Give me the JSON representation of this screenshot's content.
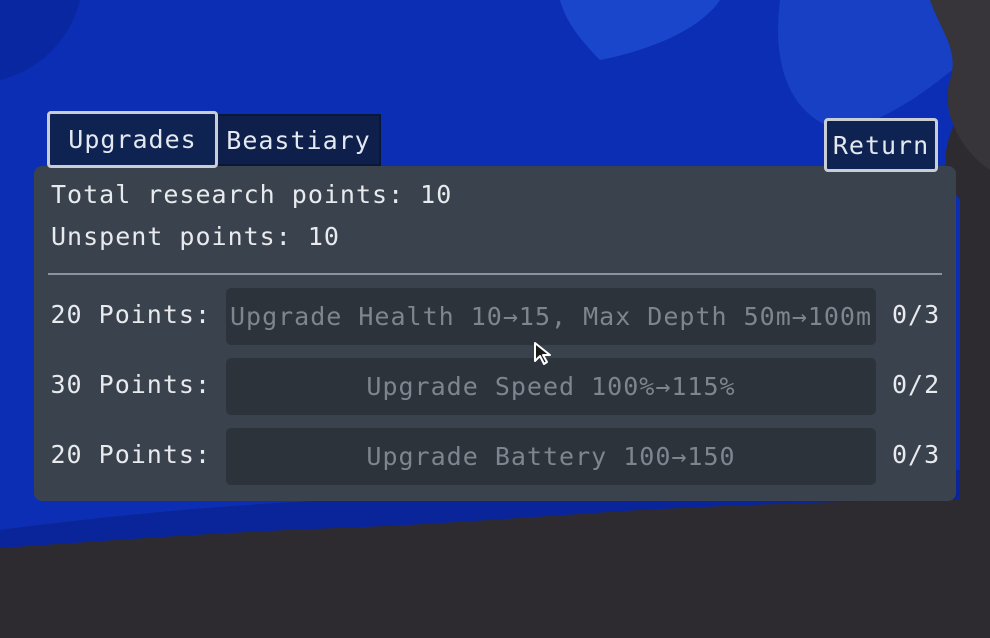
{
  "tabs": [
    {
      "label": "Upgrades",
      "active": true
    },
    {
      "label": "Beastiary",
      "active": false
    }
  ],
  "return_label": "Return",
  "stats": {
    "total_points": "Total research points: 10",
    "unspent_points": "Unspent points: 10"
  },
  "upgrades": [
    {
      "cost": "20 Points:",
      "label": "Upgrade Health 10→15, Max Depth 50m→100m",
      "progress": "0/3"
    },
    {
      "cost": "30 Points:",
      "label": "Upgrade Speed 100%→115%",
      "progress": "0/2"
    },
    {
      "cost": "20 Points:",
      "label": "Upgrade Battery 100→150",
      "progress": "0/3"
    }
  ],
  "colors": {
    "water_blue": "#0a2fb8",
    "panel": "#3a434d",
    "button_disabled": "#2c333b",
    "seabed": "#2e2b2f"
  }
}
